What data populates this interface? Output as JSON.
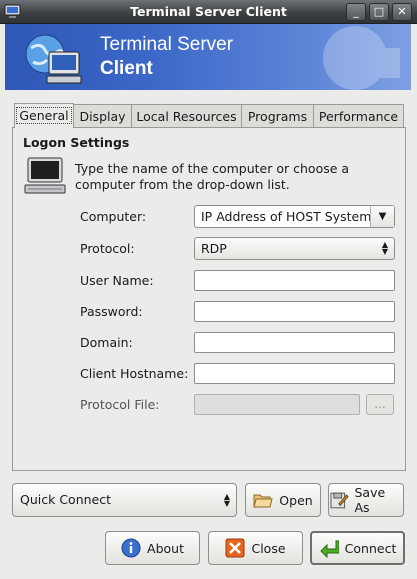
{
  "window": {
    "title": "Terminal Server Client",
    "buttons": {
      "minimize": "_",
      "maximize": "□",
      "close": "✕"
    }
  },
  "banner": {
    "line1": "Terminal Server",
    "line2": "Client"
  },
  "tabs": [
    {
      "label": "General",
      "active": true
    },
    {
      "label": "Display",
      "active": false
    },
    {
      "label": "Local Resources",
      "active": false
    },
    {
      "label": "Programs",
      "active": false
    },
    {
      "label": "Performance",
      "active": false
    }
  ],
  "logon": {
    "heading": "Logon Settings",
    "hint": "Type the name of the computer or choose a computer from the drop-down list."
  },
  "fields": {
    "computer": {
      "label": "Computer:",
      "value": "IP Address of HOST System"
    },
    "protocol": {
      "label": "Protocol:",
      "value": "RDP"
    },
    "user_name": {
      "label": "User Name:",
      "value": ""
    },
    "password": {
      "label": "Password:",
      "value": ""
    },
    "domain": {
      "label": "Domain:",
      "value": ""
    },
    "client_hostname": {
      "label": "Client Hostname:",
      "value": ""
    },
    "protocol_file": {
      "label": "Protocol File:",
      "value": "",
      "browse_label": "..."
    }
  },
  "quick_connect": {
    "value": "Quick Connect"
  },
  "buttons": {
    "open": "Open",
    "save_as": "Save As",
    "about": "About",
    "close": "Close",
    "connect": "Connect"
  },
  "colors": {
    "banner": "#3b67c7",
    "titlebar": "#3d4144",
    "window_bg": "#ebebe9"
  }
}
